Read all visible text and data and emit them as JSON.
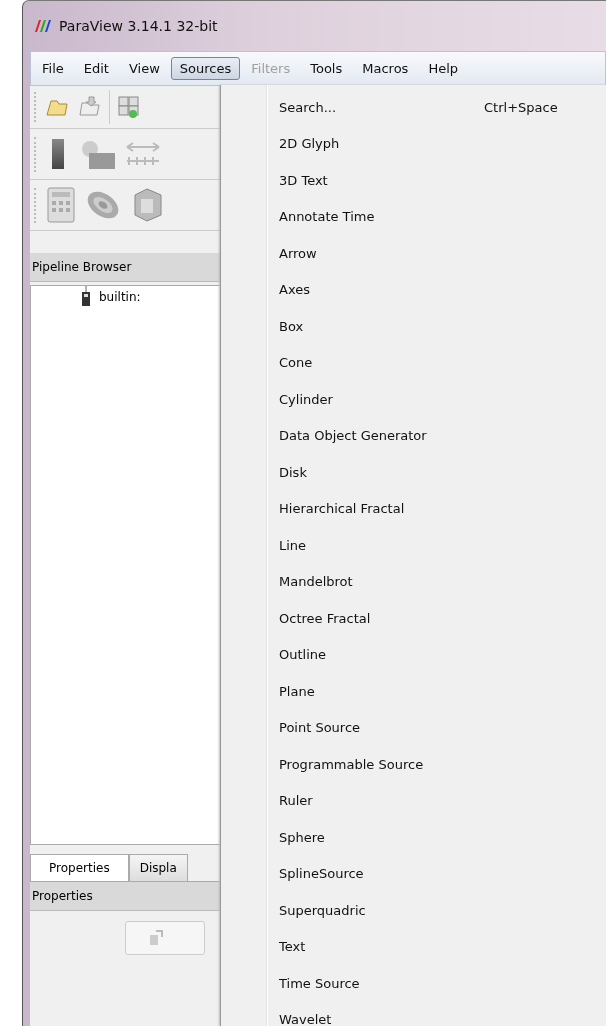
{
  "window": {
    "title": "ParaView 3.14.1 32-bit"
  },
  "menubar": [
    {
      "label": "File",
      "selected": false,
      "disabled": false
    },
    {
      "label": "Edit",
      "selected": false,
      "disabled": false
    },
    {
      "label": "View",
      "selected": false,
      "disabled": false
    },
    {
      "label": "Sources",
      "selected": true,
      "disabled": false
    },
    {
      "label": "Filters",
      "selected": false,
      "disabled": true
    },
    {
      "label": "Tools",
      "selected": false,
      "disabled": false
    },
    {
      "label": "Macros",
      "selected": false,
      "disabled": false
    },
    {
      "label": "Help",
      "selected": false,
      "disabled": false
    }
  ],
  "pipeline_browser": {
    "title": "Pipeline Browser",
    "items": [
      {
        "label": "builtin:"
      }
    ]
  },
  "tabs": [
    {
      "label": "Properties",
      "selected": true
    },
    {
      "label": "Displa",
      "selected": false
    }
  ],
  "properties": {
    "title": "Properties"
  },
  "sources_menu": [
    {
      "label": "Search...",
      "shortcut": "Ctrl+Space"
    },
    {
      "label": "2D Glyph"
    },
    {
      "label": "3D Text"
    },
    {
      "label": "Annotate Time"
    },
    {
      "label": "Arrow"
    },
    {
      "label": "Axes"
    },
    {
      "label": "Box"
    },
    {
      "label": "Cone"
    },
    {
      "label": "Cylinder"
    },
    {
      "label": "Data Object Generator"
    },
    {
      "label": "Disk"
    },
    {
      "label": "Hierarchical Fractal"
    },
    {
      "label": "Line"
    },
    {
      "label": "Mandelbrot"
    },
    {
      "label": "Octree Fractal"
    },
    {
      "label": "Outline"
    },
    {
      "label": "Plane"
    },
    {
      "label": "Point Source"
    },
    {
      "label": "Programmable Source"
    },
    {
      "label": "Ruler"
    },
    {
      "label": "Sphere"
    },
    {
      "label": "SplineSource"
    },
    {
      "label": "Superquadric"
    },
    {
      "label": "Text"
    },
    {
      "label": "Time Source"
    },
    {
      "label": "Wavelet"
    }
  ]
}
